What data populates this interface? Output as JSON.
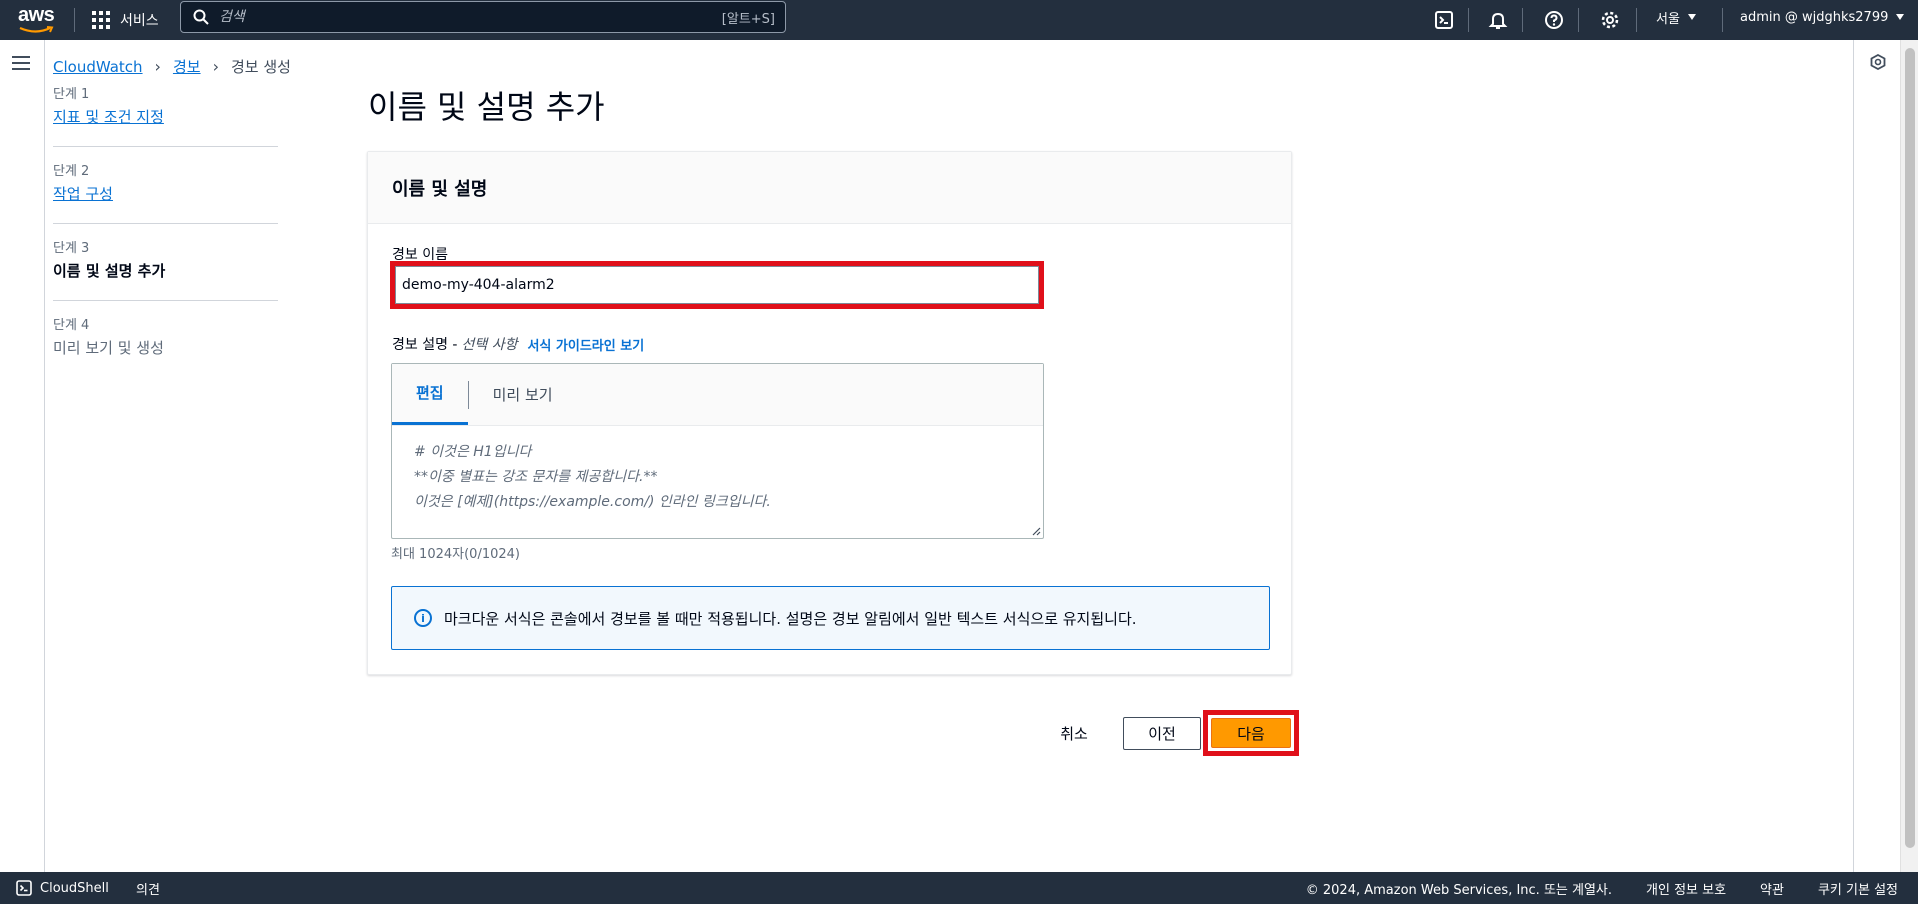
{
  "topnav": {
    "logo_text": "aws",
    "services_label": "서비스",
    "search_placeholder": "검색",
    "search_shortcut": "[알트+S]",
    "region": "서울",
    "account": "admin @ wjdghks2799",
    "icons": [
      "cloudshell-icon",
      "bell-icon",
      "help-icon",
      "gear-icon"
    ]
  },
  "breadcrumb": {
    "items": [
      "CloudWatch",
      "경보",
      "경보 생성"
    ]
  },
  "steps": [
    {
      "number": "단계 1",
      "label": "지표 및 조건 지정"
    },
    {
      "number": "단계 2",
      "label": "작업 구성"
    },
    {
      "number": "단계 3",
      "label": "이름 및 설명 추가"
    },
    {
      "number": "단계 4",
      "label": "미리 보기 및 생성"
    }
  ],
  "main": {
    "title": "이름 및 설명 추가",
    "panel_title": "이름 및 설명",
    "alarm_name_label": "경보 이름",
    "alarm_name_value": "demo-my-404-alarm2",
    "desc_label": "경보 설명 -",
    "desc_optional": "선택 사항",
    "desc_guide_link": "서식 가이드라인 보기",
    "tabs": [
      "편집",
      "미리 보기"
    ],
    "placeholder_lines": [
      "# 이것은 H1입니다",
      "**이중 별표는 강조 문자를 제공합니다.**",
      "이것은 [예제](https://example.com/) 인라인 링크입니다."
    ],
    "char_count": "최대 1024자(0/1024)",
    "info_text": "마크다운 서식은 콘솔에서 경보를 볼 때만 적용됩니다. 설명은 경보 알림에서 일반 텍스트 서식으로 유지됩니다."
  },
  "actions": {
    "cancel": "취소",
    "previous": "이전",
    "next": "다음"
  },
  "footer": {
    "cloudshell": "CloudShell",
    "feedback": "의견",
    "copyright": "© 2024, Amazon Web Services, Inc. 또는 계열사.",
    "privacy": "개인 정보 보호",
    "terms": "약관",
    "cookies": "쿠키 기본 설정"
  },
  "colors": {
    "nav_bg": "#232f3e",
    "link": "#0972d3",
    "primary_button": "#ff9900",
    "highlight": "#e0101a"
  }
}
